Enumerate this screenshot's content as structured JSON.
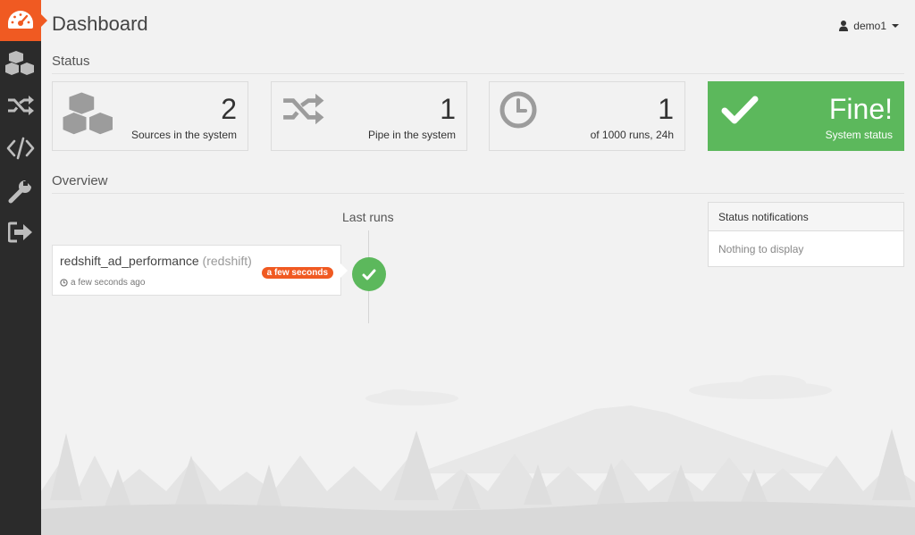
{
  "header": {
    "title": "Dashboard",
    "user": "demo1"
  },
  "status_section": {
    "title": "Status",
    "cards": [
      {
        "value": "2",
        "label": "Sources in the system",
        "icon": "cubes-icon"
      },
      {
        "value": "1",
        "label": "Pipe in the system",
        "icon": "shuffle-icon"
      },
      {
        "value": "1",
        "label": "of 1000 runs, 24h",
        "icon": "clock-icon"
      },
      {
        "value": "Fine!",
        "label": "System status",
        "icon": "check-icon",
        "color": "#5cb85c"
      }
    ]
  },
  "overview": {
    "title": "Overview",
    "last_runs_title": "Last runs",
    "runs": [
      {
        "name": "redshift_ad_performance",
        "type": "(redshift)",
        "time": "a few seconds ago",
        "badge": "a few seconds",
        "status": "success"
      }
    ]
  },
  "notifications": {
    "title": "Status notifications",
    "empty_text": "Nothing to display"
  },
  "sidebar": {
    "items": [
      {
        "icon": "dashboard-icon"
      },
      {
        "icon": "cubes-icon"
      },
      {
        "icon": "shuffle-icon"
      },
      {
        "icon": "code-icon"
      },
      {
        "icon": "wrench-icon"
      },
      {
        "icon": "sign-out-icon"
      }
    ]
  },
  "colors": {
    "accent": "#f05a22",
    "success": "#5cb85c",
    "sidebar": "#2b2b2b",
    "background": "#f2f2f2"
  }
}
